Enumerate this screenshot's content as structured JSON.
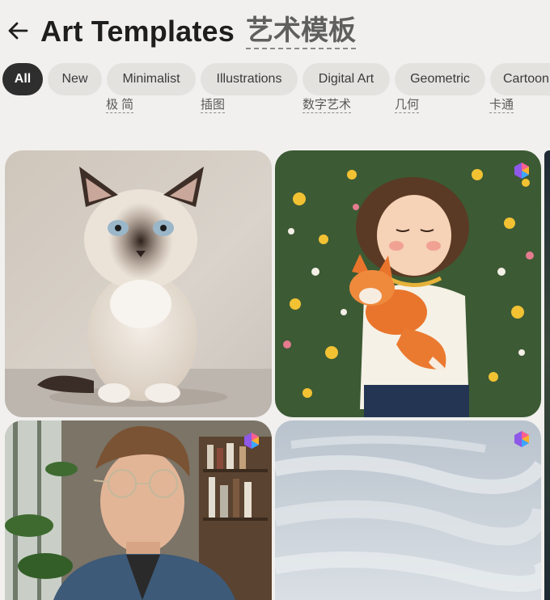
{
  "header": {
    "title": "Art Templates",
    "title_zh": "艺术模板"
  },
  "chips": [
    {
      "label": "All",
      "active": true
    },
    {
      "label": "New"
    },
    {
      "label": "Minimalist",
      "zh": "极 简"
    },
    {
      "label": "Illustrations",
      "zh": "插图"
    },
    {
      "label": "Digital Art",
      "zh": "数字艺术"
    },
    {
      "label": "Geometric",
      "zh": "几何"
    },
    {
      "label": "Cartoon",
      "zh": "卡通"
    }
  ],
  "templates": [
    {
      "name": "kitten",
      "premium": false
    },
    {
      "name": "girl-with-fox",
      "premium": true
    },
    {
      "name": "man-with-glasses",
      "premium": true
    },
    {
      "name": "sky",
      "premium": true
    }
  ],
  "colors": {
    "background": "#f1f0ee",
    "chip_bg": "#e3e2df",
    "chip_active_bg": "#2e2e2e",
    "title": "#1e1e1e"
  }
}
